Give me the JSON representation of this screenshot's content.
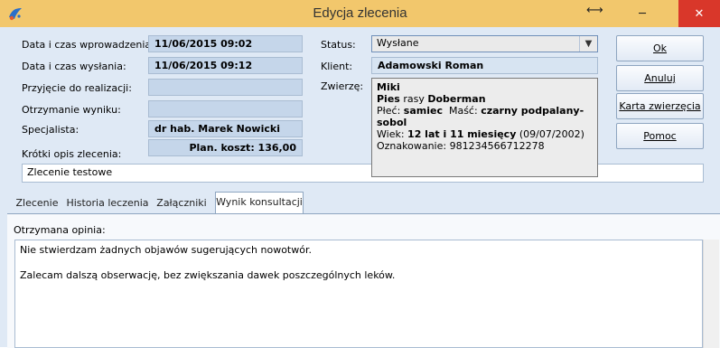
{
  "window": {
    "title": "Edycja zlecenia",
    "minimize": "─",
    "restore": "⟷",
    "close": "✕"
  },
  "fields": {
    "entered_label": "Data i czas wprowadzenia:",
    "entered_value": "11/06/2015 09:02",
    "sent_label": "Data i czas wysłania:",
    "sent_value": "11/06/2015 09:12",
    "accepted_label": "Przyjęcie do realizacji:",
    "accepted_value": "",
    "result_label": "Otrzymanie wyniku:",
    "result_value": "",
    "specialist_label": "Specjalista:",
    "specialist_value": "dr hab. Marek Nowicki",
    "plan_cost": "Plan. koszt: 136,00",
    "status_label": "Status:",
    "status_value": "Wysłane",
    "client_label": "Klient:",
    "client_value": "Adamowski Roman",
    "animal_label": "Zwierzę:",
    "desc_label": "Krótki opis zlecenia:",
    "desc_value": "Zlecenie testowe"
  },
  "animal": {
    "name": "Miki",
    "species": "Pies",
    "breed_prefix": "rasy",
    "breed": "Doberman",
    "sex_label": "Płeć:",
    "sex": "samiec",
    "color_label": "Maść:",
    "color": "czarny podpalany-sobol",
    "age_label": "Wiek:",
    "age": "12 lat i 11 miesięcy",
    "birth": "(09/07/2002)",
    "tag_label": "Oznakowanie:",
    "tag": "981234566712278"
  },
  "buttons": {
    "ok": "Ok",
    "cancel": "Anuluj",
    "animal_card": "Karta zwierzęcia",
    "help": "Pomoc"
  },
  "tabs": [
    "Zlecenie",
    "Historia leczenia",
    "Załączniki",
    "Wynik konsultacji"
  ],
  "opinion": {
    "label": "Otrzymana opinia:",
    "line1": "Nie stwierdzam żadnych objawów sugerujących nowotwór.",
    "line2": "Zalecam dalszą obserwację, bez zwiększania dawek poszczególnych leków."
  }
}
